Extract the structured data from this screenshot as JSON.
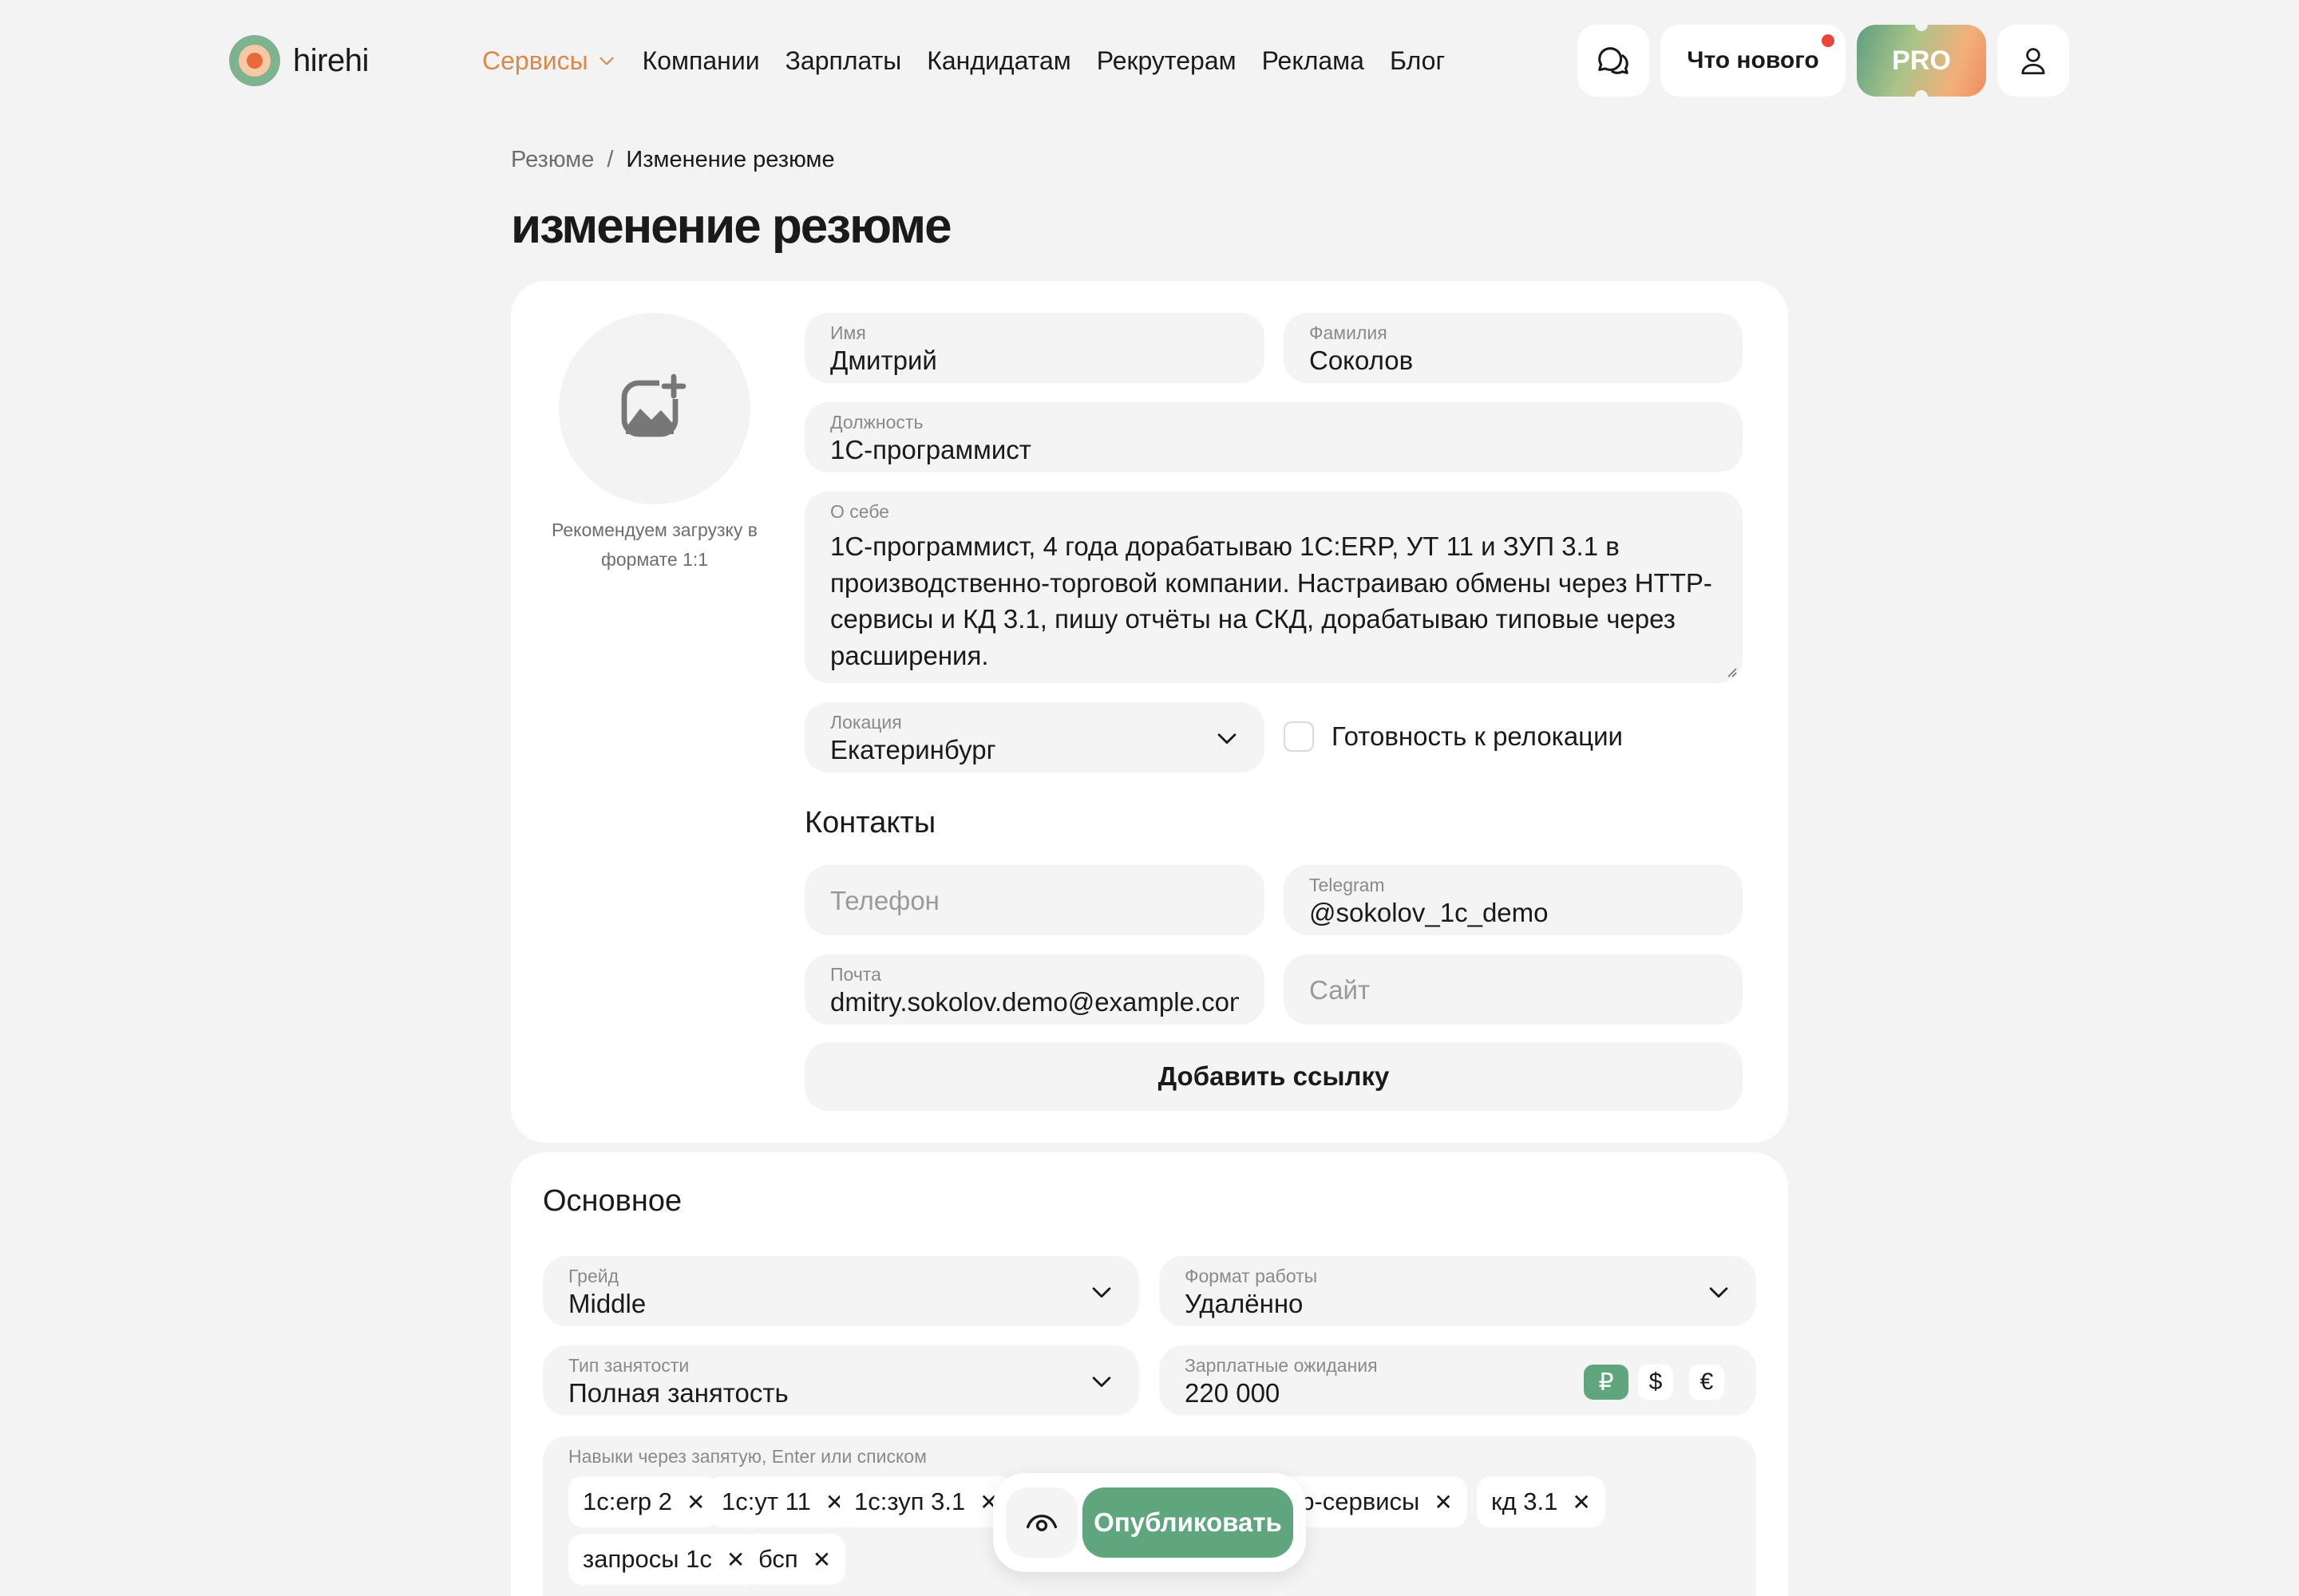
{
  "header": {
    "logo_text": "hirehi",
    "nav": [
      {
        "label": "Сервисы",
        "active": true
      },
      {
        "label": "Компании"
      },
      {
        "label": "Зарплаты"
      },
      {
        "label": "Кандидатам"
      },
      {
        "label": "Рекрутерам"
      },
      {
        "label": "Реклама"
      },
      {
        "label": "Блог"
      }
    ],
    "whats_new": "Что нового",
    "pro": "PRO",
    "accent_color": "#d9894a",
    "icons": [
      "chat-icon",
      "user-icon",
      "chevron-down-icon"
    ]
  },
  "breadcrumb": {
    "parent": "Резюме",
    "separator": "/",
    "current": "Изменение резюме"
  },
  "page_title": "изменение резюме",
  "profile": {
    "avatar_hint": "Рекомендуем загрузку в формате 1:1",
    "first_name": {
      "label": "Имя",
      "value": "Дмитрий"
    },
    "last_name": {
      "label": "Фамилия",
      "value": "Соколов"
    },
    "position": {
      "label": "Должность",
      "value": "1С-программист"
    },
    "about": {
      "label": "О себе",
      "value": "1С-программист, 4 года дорабатываю 1С:ERP, УТ 11 и ЗУП 3.1 в производственно-торговой компании. Настраиваю обмены через HTTP-сервисы и КД 3.1, пишу отчёты на СКД, дорабатываю типовые через расширения."
    },
    "location": {
      "label": "Локация",
      "value": "Екатеринбург"
    },
    "relocation": {
      "label": "Готовность к релокации",
      "checked": false
    }
  },
  "contacts": {
    "title": "Контакты",
    "phone": {
      "placeholder": "Телефон",
      "value": ""
    },
    "telegram": {
      "label": "Telegram",
      "value": "@sokolov_1c_demo"
    },
    "email": {
      "label": "Почта",
      "value": "dmitry.sokolov.demo@example.com"
    },
    "site": {
      "placeholder": "Сайт",
      "value": ""
    },
    "add_link": "Добавить ссылку"
  },
  "basics": {
    "title": "Основное",
    "grade": {
      "label": "Грейд",
      "value": "Middle"
    },
    "work_format": {
      "label": "Формат работы",
      "value": "Удалённо"
    },
    "employment": {
      "label": "Тип занятости",
      "value": "Полная занятость"
    },
    "salary": {
      "label": "Зарплатные ожидания",
      "value": "220 000",
      "currencies": [
        "₽",
        "$",
        "€"
      ],
      "selected_currency": "₽",
      "selected_color": "#5fa57e"
    },
    "skills": {
      "label": "Навыки через запятую, Enter или списком",
      "chips": [
        "1с:erp 2",
        "1с:ут 11",
        "1с:зуп 3.1",
        "http-сервисы",
        "кд 3.1",
        "запросы 1с",
        "бсп"
      ],
      "visible_chip_texts": [
        "1с:erp 2",
        "1с:ут 11",
        "1с:зуп 3.1",
        "ttp-сервисы",
        "кд 3.1",
        "запросы 1с",
        "бсп"
      ],
      "remove_glyph": "✕"
    }
  },
  "actions": {
    "publish": "Опубликовать",
    "publish_color": "#5fa57e"
  }
}
